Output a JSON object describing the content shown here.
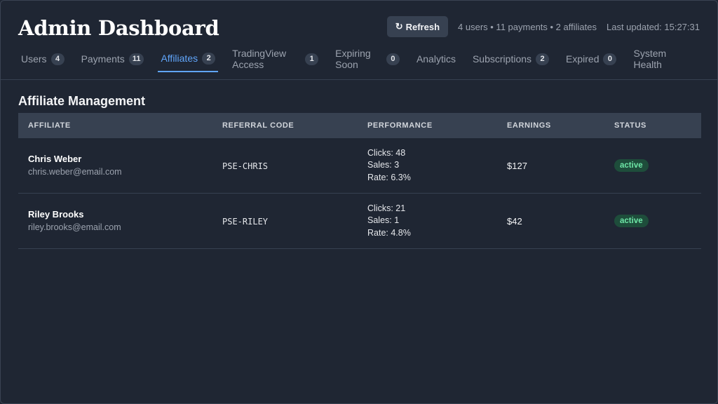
{
  "header": {
    "title": "Admin Dashboard",
    "refresh_label": "Refresh",
    "summary": "4 users • 11 payments • 2 affiliates",
    "last_updated": "Last updated: 15:27:31"
  },
  "tabs": [
    {
      "label": "Users",
      "count": "4"
    },
    {
      "label": "Payments",
      "count": "11"
    },
    {
      "label": "Affiliates",
      "count": "2",
      "active": true
    },
    {
      "label": "TradingView Access",
      "count": "1"
    },
    {
      "label": "Expiring Soon",
      "count": "0"
    },
    {
      "label": "Analytics",
      "count": null
    },
    {
      "label": "Subscriptions",
      "count": "2"
    },
    {
      "label": "Expired",
      "count": "0"
    },
    {
      "label": "System Health",
      "count": null
    }
  ],
  "section": {
    "title": "Affiliate Management",
    "columns": [
      "AFFILIATE",
      "REFERRAL CODE",
      "PERFORMANCE",
      "EARNINGS",
      "STATUS"
    ],
    "rows": [
      {
        "name": "Chris Weber",
        "email": "chris.weber@email.com",
        "code": "PSE-CHRIS",
        "clicks": "Clicks: 48",
        "sales": "Sales: 3",
        "rate": "Rate: 6.3%",
        "earnings": "$127",
        "status": "active"
      },
      {
        "name": "Riley Brooks",
        "email": "riley.brooks@email.com",
        "code": "PSE-RILEY",
        "clicks": "Clicks: 21",
        "sales": "Sales: 1",
        "rate": "Rate: 4.8%",
        "earnings": "$42",
        "status": "active"
      }
    ]
  },
  "colors": {
    "background": "#1f2633",
    "accent": "#60a5fa",
    "status_active_bg": "#1e4d3b",
    "status_active_fg": "#6ee7a7"
  }
}
